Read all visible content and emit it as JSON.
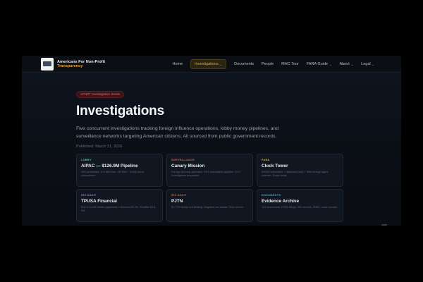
{
  "brand": {
    "line1": "Americans For Non-Profit",
    "line2": "Transparency",
    "logo_icon": "afnpt-logo-icon"
  },
  "nav": {
    "items": [
      {
        "label": "Home",
        "dropdown": false,
        "active": false
      },
      {
        "label": "Investigations",
        "dropdown": true,
        "active": true
      },
      {
        "label": "Documents",
        "dropdown": false,
        "active": false
      },
      {
        "label": "People",
        "dropdown": false,
        "active": false
      },
      {
        "label": "MHC Tour",
        "dropdown": false,
        "active": false
      },
      {
        "label": "FARA Guide",
        "dropdown": true,
        "active": false
      },
      {
        "label": "About",
        "dropdown": true,
        "active": false
      },
      {
        "label": "Legal",
        "dropdown": true,
        "active": false
      }
    ],
    "caret_glyph": "⌄"
  },
  "hero": {
    "badge": "AFNPT Investigation Series",
    "title": "Investigations",
    "description": "Five concurrent investigations tracking foreign influence operations, lobby money pipelines, and surveillance networks targeting American citizens. All sourced from public government records.",
    "published": "Published: March 31, 2026"
  },
  "cards": [
    {
      "tag": "LOBBY",
      "tag_color": "#3fcf7a",
      "title": "AIPAC — $126.9M Pipeline",
      "desc": "356 candidates. 8 in 865 lists. HR 8381. Trump donor connections."
    },
    {
      "tag": "SURVEILLANCE",
      "tag_color": "#e0603a",
      "title": "Canary Mission",
      "desc": "Foreign doxxing operation. DHS deportation pipeline. DOJ investigation requested."
    },
    {
      "tag": "FARA",
      "tag_color": "#e8b23a",
      "title": "Clock Tower",
      "desc": "$300M placement + disclosed work + NBA foreign agent contract. Script ideas."
    },
    {
      "tag": "990 AUDIT",
      "tag_color": "#b06ae0",
      "title": "TPUSA Financial",
      "desc": "$12.9-34.9M hidden payments. Influencer 60-90. Shuttles $4.5-5M."
    },
    {
      "tag": "990 AUDIT",
      "tag_color": "#e0603a",
      "title": "PJTN",
      "desc": "$1.77M family self-dealing. Negative net assets. 501c reform."
    },
    {
      "tag": "DOCUMENTS",
      "tag_color": "#3fa6e0",
      "title": "Evidence Archive",
      "desc": "104 documents. FARA filings, 990 records, IRMO, court records."
    }
  ]
}
